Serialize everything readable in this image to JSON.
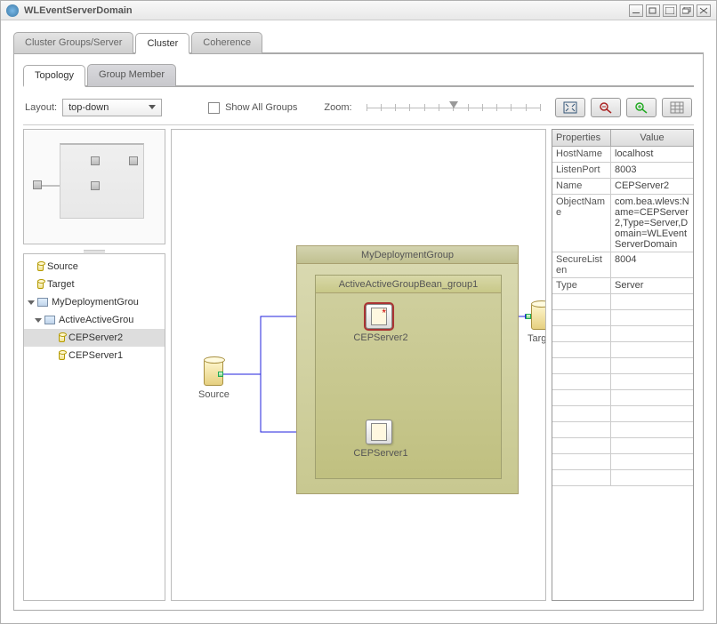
{
  "title": "WLEventServerDomain",
  "main_tabs": [
    {
      "label": "Cluster Groups/Server",
      "active": false
    },
    {
      "label": "Cluster",
      "active": true
    },
    {
      "label": "Coherence",
      "active": false
    }
  ],
  "sub_tabs": [
    {
      "label": "Topology",
      "active": true
    },
    {
      "label": "Group Member",
      "active": false
    }
  ],
  "toolbar": {
    "layout_label": "Layout:",
    "layout_value": "top-down",
    "show_all_groups_label": "Show All Groups",
    "zoom_label": "Zoom:"
  },
  "tree": {
    "items": [
      {
        "label": "Source",
        "kind": "db",
        "indent": 0
      },
      {
        "label": "Target",
        "kind": "db",
        "indent": 0
      },
      {
        "label": "MyDeploymentGrou",
        "kind": "group",
        "indent": 0,
        "expanded": true
      },
      {
        "label": "ActiveActiveGrou",
        "kind": "group",
        "indent": 1,
        "expanded": true
      },
      {
        "label": "CEPServer2",
        "kind": "db",
        "indent": 2,
        "selected": true
      },
      {
        "label": "CEPServer1",
        "kind": "db",
        "indent": 2
      }
    ]
  },
  "canvas": {
    "source_label": "Source",
    "target_label": "Target",
    "group_label": "MyDeploymentGroup",
    "inner_group_label": "ActiveActiveGroupBean_group1",
    "server1_label": "CEPServer2",
    "server2_label": "CEPServer1"
  },
  "properties": {
    "header_key": "Properties",
    "header_val": "Value",
    "rows": [
      {
        "k": "HostName",
        "v": "localhost"
      },
      {
        "k": "ListenPort",
        "v": "8003"
      },
      {
        "k": "Name",
        "v": "CEPServer2"
      },
      {
        "k": "ObjectName",
        "v": "com.bea.wlevs:Name=CEPServer2,Type=Server,Domain=WLEventServerDomain"
      },
      {
        "k": "SecureListen",
        "v": "8004"
      },
      {
        "k": "Type",
        "v": "Server"
      }
    ],
    "empty_rows": 12
  }
}
